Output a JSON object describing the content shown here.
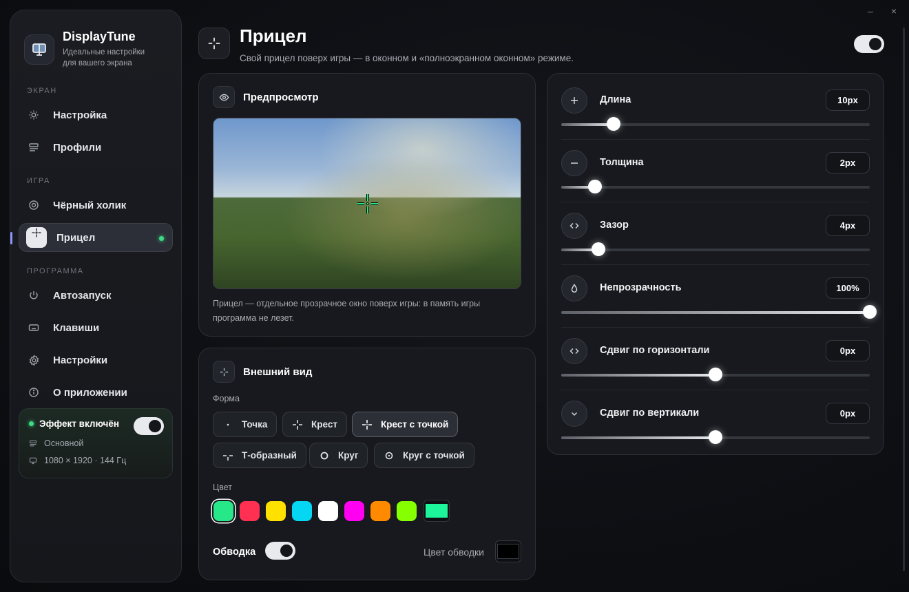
{
  "window": {
    "minimize": "–",
    "close": "×"
  },
  "app": {
    "name": "DisplayTune",
    "subtitle_line1": "Идеальные настройки",
    "subtitle_line2": "для вашего экрана"
  },
  "sidebar": {
    "sections": [
      {
        "label": "ЭКРАН",
        "items": [
          {
            "label": "Настройка",
            "icon": "sun-icon"
          },
          {
            "label": "Профили",
            "icon": "profiles-icon"
          }
        ]
      },
      {
        "label": "ИГРА",
        "items": [
          {
            "label": "Чёрный холик",
            "icon": "target-icon"
          },
          {
            "label": "Прицел",
            "icon": "crosshair-icon",
            "active": true
          }
        ]
      },
      {
        "label": "ПРОГРАММА",
        "items": [
          {
            "label": "Автозапуск",
            "icon": "power-icon"
          },
          {
            "label": "Клавиши",
            "icon": "keyboard-icon"
          },
          {
            "label": "Настройки",
            "icon": "gear-icon"
          },
          {
            "label": "О приложении",
            "icon": "info-icon"
          }
        ]
      }
    ],
    "effect": {
      "title": "Эффект включён",
      "enabled": true,
      "profile": "Основной",
      "display": "1080 × 1920 · 144 Гц"
    }
  },
  "header": {
    "title": "Прицел",
    "subtitle": "Свой прицел поверх игры — в оконном и «полноэкранном оконном» режиме.",
    "enabled": true
  },
  "preview": {
    "title": "Предпросмотр",
    "note": "Прицел — отдельное прозрачное окно поверх игры: в память игры программа не лезет."
  },
  "appearance": {
    "title": "Внешний вид",
    "shape_label": "Форма",
    "shapes": [
      "Точка",
      "Крест",
      "Крест с точкой",
      "Т-образный",
      "Круг",
      "Круг с точкой"
    ],
    "selected_shape": "Крест с точкой",
    "color_label": "Цвет",
    "colors": [
      "#26e889",
      "#ff3052",
      "#ffe100",
      "#05d7f2",
      "#ffffff",
      "#ff00f0",
      "#ff8a00",
      "#86ff00"
    ],
    "selected_color": "#26e889",
    "custom_color": "#1cf59a",
    "outline_label": "Обводка",
    "outline_enabled": true,
    "outline_color_label": "Цвет обводки",
    "outline_color": "#000000"
  },
  "sliders": [
    {
      "label": "Длина",
      "value": "10px",
      "icon": "plus-icon",
      "fraction": 0.17
    },
    {
      "label": "Толщина",
      "value": "2px",
      "icon": "minus-icon",
      "fraction": 0.11
    },
    {
      "label": "Зазор",
      "value": "4px",
      "icon": "code-brackets-icon",
      "fraction": 0.12
    },
    {
      "label": "Непрозрачность",
      "value": "100%",
      "icon": "drop-icon",
      "fraction": 1.0
    },
    {
      "label": "Сдвиг по горизонтали",
      "value": "0px",
      "icon": "code-brackets-icon",
      "fraction": 0.5
    },
    {
      "label": "Сдвиг по вертикали",
      "value": "0px",
      "icon": "chevron-down-icon",
      "fraction": 0.5
    }
  ]
}
